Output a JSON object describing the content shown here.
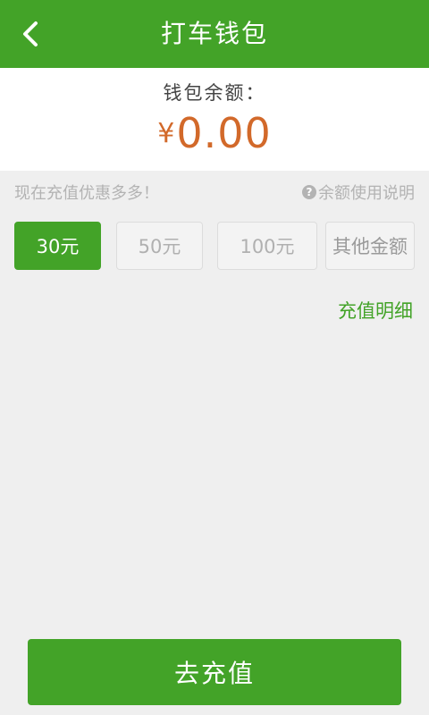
{
  "header": {
    "title": "打车钱包",
    "back_icon": "back-chevron-icon"
  },
  "balance": {
    "label": "钱包余额：",
    "currency": "¥",
    "value": "0.00"
  },
  "promo": {
    "text": "现在充值优惠多多！",
    "help_icon": "question-circle-icon",
    "help_text": "余额使用说明"
  },
  "amount_options": [
    {
      "label": "30元",
      "selected": true
    },
    {
      "label": "50元",
      "selected": false
    },
    {
      "label": "100元",
      "selected": false
    },
    {
      "label": "其他金额",
      "selected": false
    }
  ],
  "detail_link": "充值明细",
  "recharge_button": "去充值",
  "colors": {
    "primary_green": "#43a328",
    "amount_orange": "#d2692a",
    "background": "#efefef"
  }
}
